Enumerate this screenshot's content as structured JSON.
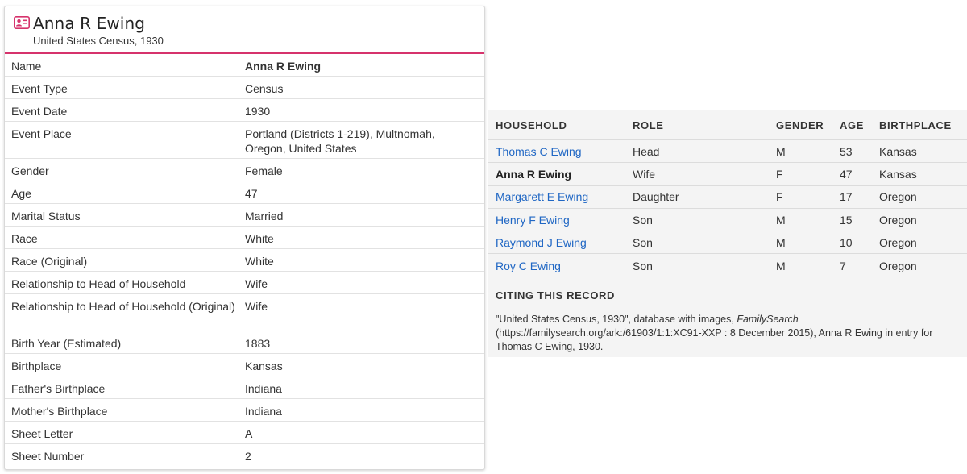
{
  "record": {
    "title": "Anna R Ewing",
    "collection": "United States Census, 1930",
    "icon": "record-card-icon",
    "accent_color": "#d6336c"
  },
  "fields": [
    {
      "label": "Name",
      "value": "Anna R Ewing",
      "bold": true
    },
    {
      "label": "Event Type",
      "value": "Census"
    },
    {
      "label": "Event Date",
      "value": "1930"
    },
    {
      "label": "Event Place",
      "value": "Portland (Districts 1-219), Multnomah, Oregon, United States",
      "tall": true
    },
    {
      "label": "Gender",
      "value": "Female"
    },
    {
      "label": "Age",
      "value": "47"
    },
    {
      "label": "Marital Status",
      "value": "Married"
    },
    {
      "label": "Race",
      "value": "White"
    },
    {
      "label": "Race (Original)",
      "value": "White"
    },
    {
      "label": "Relationship to Head of Household",
      "value": "Wife"
    },
    {
      "label": "Relationship to Head of Household (Original)",
      "value": "Wife",
      "tall": true
    },
    {
      "label": "Birth Year (Estimated)",
      "value": "1883"
    },
    {
      "label": "Birthplace",
      "value": "Kansas"
    },
    {
      "label": "Father's Birthplace",
      "value": "Indiana"
    },
    {
      "label": "Mother's Birthplace",
      "value": "Indiana"
    },
    {
      "label": "Sheet Letter",
      "value": "A"
    },
    {
      "label": "Sheet Number",
      "value": "2"
    }
  ],
  "household": {
    "headers": {
      "household": "HOUSEHOLD",
      "role": "ROLE",
      "gender": "GENDER",
      "age": "AGE",
      "birthplace": "BIRTHPLACE"
    },
    "link_color": "#2067c4",
    "rows": [
      {
        "name": "Thomas C Ewing",
        "role": "Head",
        "gender": "M",
        "age": "53",
        "birthplace": "Kansas",
        "link": true
      },
      {
        "name": "Anna R Ewing",
        "role": "Wife",
        "gender": "F",
        "age": "47",
        "birthplace": "Kansas",
        "link": false
      },
      {
        "name": "Margarett E Ewing",
        "role": "Daughter",
        "gender": "F",
        "age": "17",
        "birthplace": "Oregon",
        "link": true
      },
      {
        "name": "Henry F Ewing",
        "role": "Son",
        "gender": "M",
        "age": "15",
        "birthplace": "Oregon",
        "link": true
      },
      {
        "name": "Raymond J Ewing",
        "role": "Son",
        "gender": "M",
        "age": "10",
        "birthplace": "Oregon",
        "link": true
      },
      {
        "name": "Roy C Ewing",
        "role": "Son",
        "gender": "M",
        "age": "7",
        "birthplace": "Oregon",
        "link": true
      }
    ]
  },
  "citation": {
    "title": "CITING THIS RECORD",
    "text_before": "\"United States Census, 1930\", database with images, ",
    "text_italic": "FamilySearch",
    "text_after": " (https://familysearch.org/ark:/61903/1:1:XC91-XXP : 8 December 2015), Anna R Ewing in entry for Thomas C Ewing, 1930."
  }
}
